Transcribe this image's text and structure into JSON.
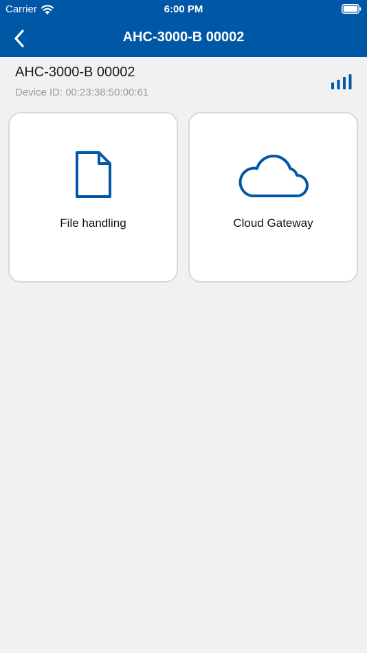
{
  "status_bar": {
    "carrier": "Carrier",
    "time": "6:00 PM",
    "wifi_icon": "wifi-icon",
    "battery_icon": "battery-icon"
  },
  "nav": {
    "title": "AHC-3000-B 00002",
    "back_icon": "chevron-left-icon"
  },
  "device": {
    "name": "AHC-3000-B 00002",
    "id_label": "Device ID:",
    "id_value": "00:23:38:50:00:61",
    "signal_icon": "signal-bars-icon"
  },
  "tiles": [
    {
      "label": "File handling",
      "icon": "document-icon"
    },
    {
      "label": "Cloud Gateway",
      "icon": "cloud-icon"
    }
  ],
  "colors": {
    "primary": "#0057a5",
    "background": "#f0f1f0",
    "card": "#ffffff",
    "card_border": "#d7d9d8",
    "muted_text": "#9a9a9a"
  }
}
